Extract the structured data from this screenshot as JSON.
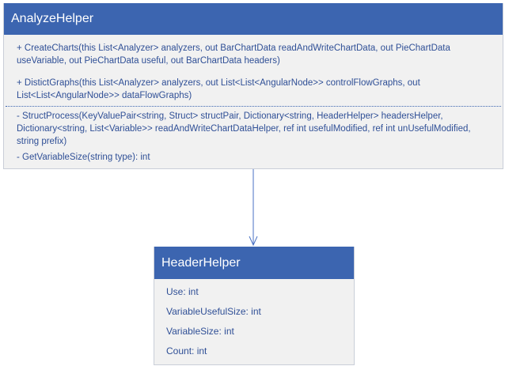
{
  "analyze_helper": {
    "name": "AnalyzeHelper",
    "public_members": [
      "+ CreateCharts(this List<Analyzer> analyzers, out BarChartData readAndWriteChartData, out PieChartData useVariable, out PieChartData useful, out BarChartData headers)",
      "+ DistictGraphs(this List<Analyzer> analyzers, out List<List<AngularNode>> controlFlowGraphs, out List<List<AngularNode>> dataFlowGraphs)"
    ],
    "private_members": [
      "- StructProcess(KeyValuePair<string, Struct> structPair, Dictionary<string, HeaderHelper> headersHelper, Dictionary<string, List<Variable>> readAndWriteChartDataHelper, ref int usefulModified, ref int unUsefulModified, string prefix)",
      "- GetVariableSize(string type): int"
    ]
  },
  "header_helper": {
    "name": "HeaderHelper",
    "attributes": [
      "Use: int",
      "VariableUsefulSize: int",
      "VariableSize: int",
      "Count: int"
    ]
  },
  "colors": {
    "header_fill": "#3c65b0",
    "body_fill": "#f1f1f1",
    "text": "#2f4f96",
    "connector": "#4a72c4"
  }
}
